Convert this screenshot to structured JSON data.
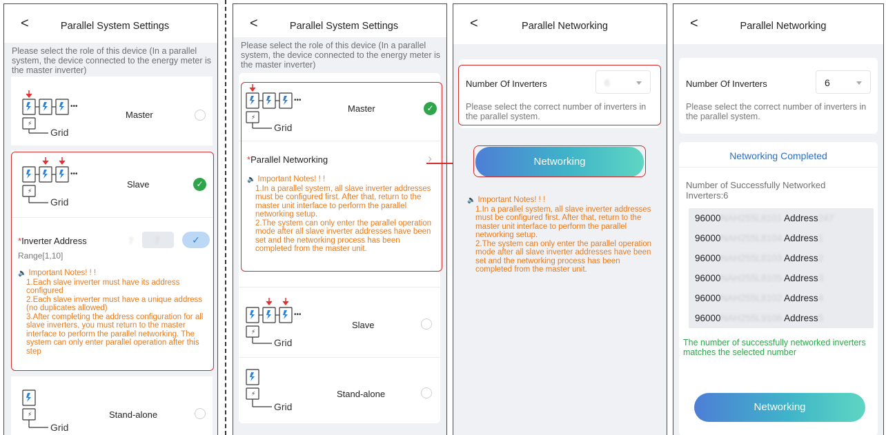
{
  "panel1": {
    "back": "<",
    "title": "Parallel System Settings",
    "hint": "Please select the role of this device (In a parallel system, the device connected to the energy meter is the master inverter)",
    "roles": [
      {
        "label": "Master",
        "grid": "Grid"
      },
      {
        "label": "Slave",
        "grid": "Grid"
      },
      {
        "label": "Stand-alone",
        "grid": "Grid"
      }
    ],
    "address": {
      "label": "Inverter Address",
      "required_mark": "*",
      "prefix": "7",
      "value": "7",
      "range": "Range[1,10]",
      "confirm": "✓"
    },
    "notes": {
      "head": "Important Notes! ! !",
      "lines": [
        "1.Each slave inverter must have its address configured",
        "2.Each slave inverter must have a unique address (no duplicates allowed)",
        "3.After completing the address configuration for all slave inverters, you must return to the master interface to perform the parallel networking. The system can only enter parallel operation after this step"
      ]
    }
  },
  "panel2": {
    "back": "<",
    "title": "Parallel System Settings",
    "hint": "Please select the role of this device (In a parallel system, the device connected to the energy meter is the master inverter)",
    "roles": [
      {
        "label": "Master",
        "grid": "Grid"
      },
      {
        "label": "Slave",
        "grid": "Grid"
      },
      {
        "label": "Stand-alone",
        "grid": "Grid"
      }
    ],
    "networking_row": {
      "required_mark": "*",
      "label": "Parallel Networking",
      "chevron": "›"
    },
    "notes": {
      "head": "Important Notes! ! !",
      "lines": [
        "1.In a parallel system, all slave inverter addresses must be configured first. After that, return to the master unit interface to perform the parallel networking setup.",
        "2.The system can only enter the parallel operation mode after all slave inverter addresses have been set and the networking process has been completed from the master unit."
      ]
    }
  },
  "panel3": {
    "back": "<",
    "title": "Parallel Networking",
    "inverters_label": "Number Of Inverters",
    "inverters_value": "6",
    "select_hint": "Please select the correct number of inverters in the parallel system.",
    "button": "Networking",
    "notes": {
      "head": "Important Notes! ! !",
      "lines": [
        "1.In a parallel system, all slave inverter addresses must be configured first. After that, return to the master unit interface to perform the parallel networking setup.",
        "2.The system can only enter the parallel operation mode after all slave inverter addresses have been set and the networking process has been completed from the master unit."
      ]
    }
  },
  "panel4": {
    "back": "<",
    "title": "Parallel Networking",
    "inverters_label": "Number Of Inverters",
    "inverters_value": "6",
    "select_hint": "Please select the correct number of inverters in the parallel system.",
    "completed_title": "Networking Completed",
    "success_label": "Number of Successfully Networked Inverters:6",
    "devices": [
      {
        "sn_prefix": "96000",
        "sn_hidden": "NAH255L8101",
        "addr_label": "Address",
        "addr": "247"
      },
      {
        "sn_prefix": "96000",
        "sn_hidden": "NAH255L8104",
        "addr_label": "Address",
        "addr": "1"
      },
      {
        "sn_prefix": "96000",
        "sn_hidden": "NAH255L8103",
        "addr_label": "Address",
        "addr": "2"
      },
      {
        "sn_prefix": "96000",
        "sn_hidden": "NAH255L8105",
        "addr_label": "Address",
        "addr": "3"
      },
      {
        "sn_prefix": "96000",
        "sn_hidden": "NAH255L8102",
        "addr_label": "Address",
        "addr": "4"
      },
      {
        "sn_prefix": "96000",
        "sn_hidden": "NAH255L9106",
        "addr_label": "Address",
        "addr": "5"
      }
    ],
    "match_msg": "The number of successfully networked inverters matches the selected number",
    "button": "Networking"
  },
  "colors": {
    "highlight": "#d42a2a",
    "check_green": "#2fa44b",
    "notes_orange": "#ea7a1c",
    "success_green": "#2fa44b",
    "link_blue": "#2b6fc4",
    "button_gradient": [
      "#4e7ed6",
      "#3fb4c9",
      "#5ed6c2"
    ]
  },
  "icons": [
    "back-chevron-icon",
    "single-inverter-grid-icon",
    "triple-inverter-grid-icon",
    "check-circle-icon",
    "radio-circle-icon",
    "speaker-icon",
    "dropdown-caret-icon",
    "chevron-right-icon",
    "arrow-right-icon"
  ]
}
